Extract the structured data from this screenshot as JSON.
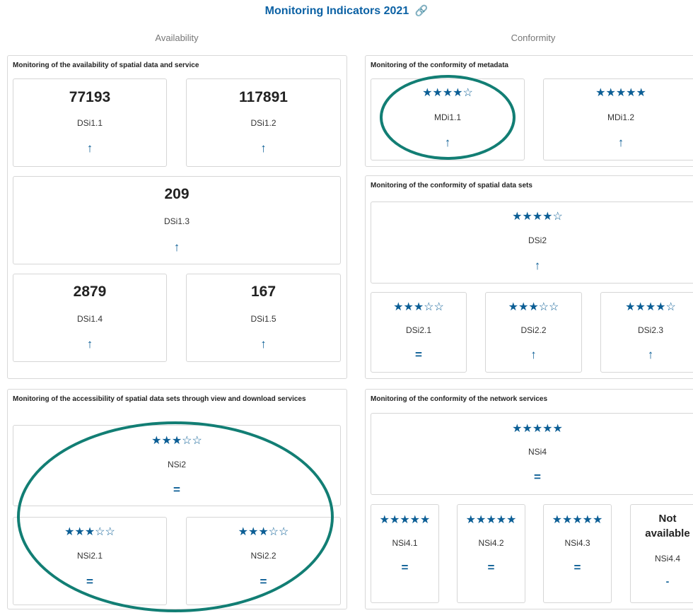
{
  "title": "Monitoring Indicators 2021",
  "link_icon": "link-icon",
  "columns": {
    "availability": "Availability",
    "conformity": "Conformity"
  },
  "panels": {
    "availability": {
      "title": "Monitoring of the availability of spatial data and service",
      "cards": [
        {
          "value": "77193",
          "label": "DSi1.1",
          "trend": "↑"
        },
        {
          "value": "117891",
          "label": "DSi1.2",
          "trend": "↑"
        },
        {
          "value": "209",
          "label": "DSi1.3",
          "trend": "↑"
        },
        {
          "value": "2879",
          "label": "DSi1.4",
          "trend": "↑"
        },
        {
          "value": "167",
          "label": "DSi1.5",
          "trend": "↑"
        }
      ]
    },
    "accessibility": {
      "title": "Monitoring of the accessibility of spatial data sets through view and download services",
      "cards": [
        {
          "stars": "★★★☆☆",
          "rating": 3,
          "label": "NSi2",
          "trend": "="
        },
        {
          "stars": "★★★☆☆",
          "rating": 3,
          "label": "NSi2.1",
          "trend": "="
        },
        {
          "stars": "★★★☆☆",
          "rating": 3,
          "label": "NSi2.2",
          "trend": "="
        }
      ]
    },
    "metadata": {
      "title": "Monitoring of the conformity of metadata",
      "cards": [
        {
          "stars": "★★★★☆",
          "rating": 4,
          "label": "MDi1.1",
          "trend": "↑"
        },
        {
          "stars": "★★★★★",
          "rating": 5,
          "label": "MDi1.2",
          "trend": "↑"
        }
      ]
    },
    "datasets": {
      "title": "Monitoring of the conformity of spatial data sets",
      "cards": [
        {
          "stars": "★★★★☆",
          "rating": 4,
          "label": "DSi2",
          "trend": "↑"
        },
        {
          "stars": "★★★☆☆",
          "rating": 3,
          "label": "DSi2.1",
          "trend": "="
        },
        {
          "stars": "★★★☆☆",
          "rating": 3,
          "label": "DSi2.2",
          "trend": "↑"
        },
        {
          "stars": "★★★★☆",
          "rating": 4,
          "label": "DSi2.3",
          "trend": "↑"
        }
      ]
    },
    "network": {
      "title": "Monitoring of the conformity of the network services",
      "cards": [
        {
          "stars": "★★★★★",
          "rating": 5,
          "label": "NSi4",
          "trend": "="
        },
        {
          "stars": "★★★★★",
          "rating": 5,
          "label": "NSi4.1",
          "trend": "="
        },
        {
          "stars": "★★★★★",
          "rating": 5,
          "label": "NSi4.2",
          "trend": "="
        },
        {
          "stars": "★★★★★",
          "rating": 5,
          "label": "NSi4.3",
          "trend": "="
        },
        {
          "status_line1": "Not",
          "status_line2": "available",
          "label": "NSi4.4",
          "trend": "-"
        }
      ]
    }
  },
  "colors": {
    "title": "#0b61a4",
    "stars": "#0b5e95",
    "highlight": "#127e74"
  }
}
